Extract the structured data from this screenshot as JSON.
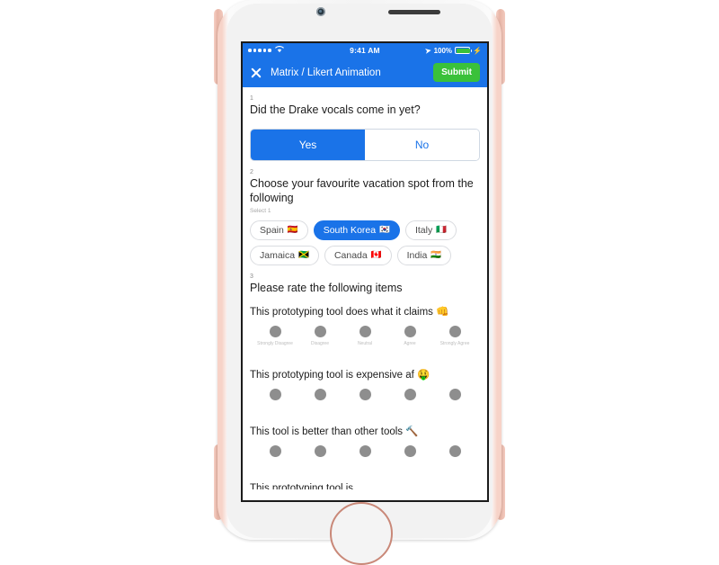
{
  "device": {
    "name": "iphone-rose-gold",
    "camera": "front-camera",
    "speaker": "earpiece-speaker",
    "home": "home-button"
  },
  "colors": {
    "brand_blue": "#1a73e8",
    "submit_green": "#3ac13a",
    "dot_gray": "#8e8e8e",
    "chip_border": "#dadce0",
    "label_gray": "#bdbdbd"
  },
  "status_bar": {
    "signal_dots": 5,
    "wifi_icon": "wifi-icon",
    "time": "9:41 AM",
    "location_icon": "location-arrow-icon",
    "battery_percent": "100%",
    "charging_icon": "lightning-bolt-icon"
  },
  "nav_bar": {
    "close_icon": "close-x-icon",
    "title": "Matrix / Likert Animation",
    "submit_label": "Submit"
  },
  "questions": [
    {
      "number": "1",
      "title": "Did the Drake vocals come in yet?",
      "type": "segmented",
      "options": [
        {
          "label": "Yes",
          "selected": true
        },
        {
          "label": "No",
          "selected": false
        }
      ]
    },
    {
      "number": "2",
      "title": "Choose your favourite vacation spot from the following",
      "hint": "Select 1",
      "type": "chips",
      "rows": [
        [
          {
            "label": "Spain",
            "flag": "🇪🇸",
            "selected": false
          },
          {
            "label": "South Korea",
            "flag": "🇰🇷",
            "selected": true
          },
          {
            "label": "Italy",
            "flag": "🇮🇹",
            "selected": false
          }
        ],
        [
          {
            "label": "Jamaica",
            "flag": "🇯🇲",
            "selected": false
          },
          {
            "label": "Canada",
            "flag": "🇨🇦",
            "selected": false
          },
          {
            "label": "India",
            "flag": "🇮🇳",
            "selected": false
          }
        ]
      ]
    },
    {
      "number": "3",
      "title": "Please rate the following items",
      "type": "matrix",
      "scale": [
        "Strongly Disagree",
        "Disagree",
        "Neutral",
        "Agree",
        "Strongly Agree"
      ],
      "rows": [
        {
          "label": "This prototyping tool does what it claims 👊",
          "show_scale_labels": true
        },
        {
          "label": "This prototyping tool is expensive af 🤑",
          "show_scale_labels": false
        },
        {
          "label": "This tool is better than other tools 🔨",
          "show_scale_labels": false
        }
      ],
      "clipped_row_label": "This prototyping tool is ..."
    }
  ]
}
